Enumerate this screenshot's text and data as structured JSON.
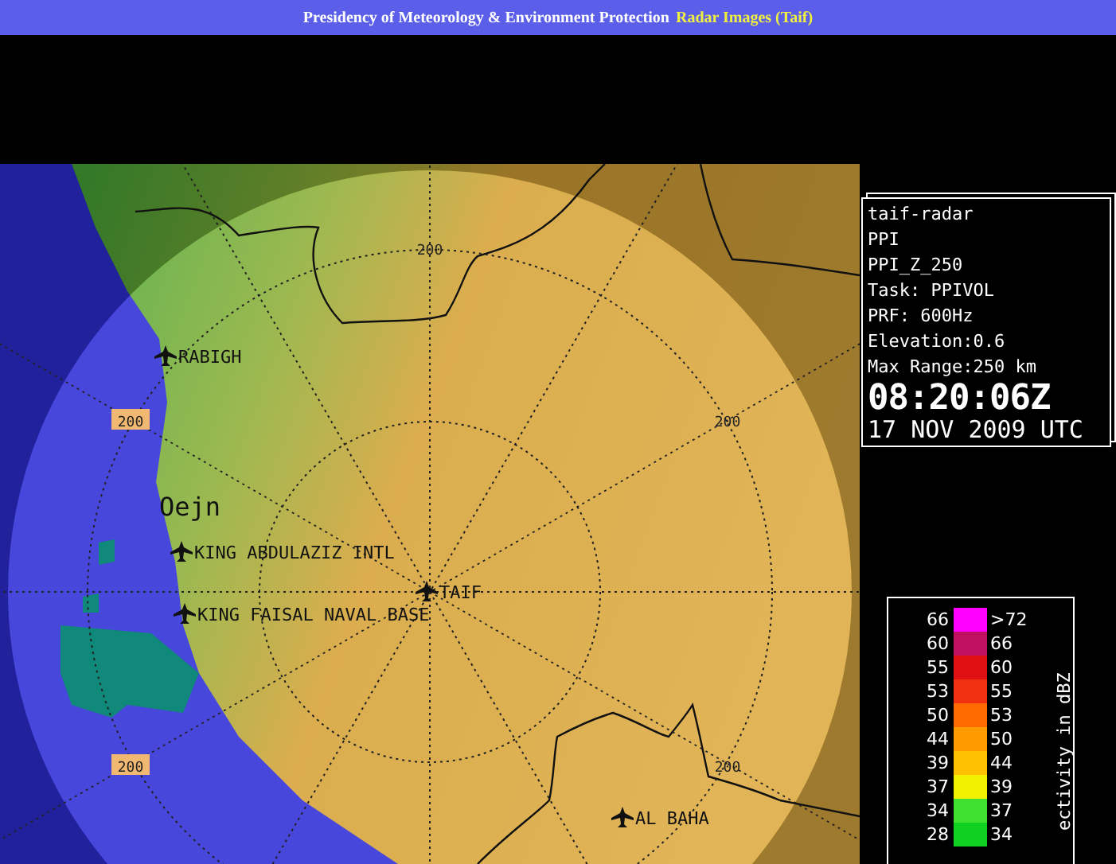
{
  "header": {
    "title": "Presidency of Meteorology & Environment Protection",
    "subtitle": "Radar Images (Taif)"
  },
  "map": {
    "range_labels": [
      {
        "text": "200",
        "kind": "plain"
      },
      {
        "text": "200",
        "kind": "plain"
      },
      {
        "text": "200",
        "kind": "boxed"
      },
      {
        "text": "200",
        "kind": "plain"
      },
      {
        "text": "200",
        "kind": "boxed"
      }
    ],
    "places": [
      {
        "name": "RABIGH",
        "kind": "airport"
      },
      {
        "name": "Oejn",
        "kind": "code"
      },
      {
        "name": "KING ABDULAZIZ INTL",
        "kind": "airport"
      },
      {
        "name": "TAIF",
        "kind": "airport"
      },
      {
        "name": "KING FAISAL NAVAL BASE",
        "kind": "airport"
      },
      {
        "name": "AL BAHA",
        "kind": "airport"
      }
    ]
  },
  "info": {
    "lines": [
      "taif-radar",
      "PPI",
      "PPI_Z_250",
      "Task: PPIVOL",
      "PRF: 600Hz",
      "Elevation:0.6",
      "Max Range:250 km"
    ],
    "time": "08:20:06Z",
    "date": "17 NOV 2009 UTC"
  },
  "legend": {
    "title": "ectivity in dBZ",
    "rows": [
      {
        "low": "66",
        "high": ">72",
        "color": "#ff00ff"
      },
      {
        "low": "60",
        "high": "66",
        "color": "#c01060"
      },
      {
        "low": "55",
        "high": "60",
        "color": "#e01010"
      },
      {
        "low": "53",
        "high": "55",
        "color": "#f03010"
      },
      {
        "low": "50",
        "high": "53",
        "color": "#ff6a00"
      },
      {
        "low": "44",
        "high": "50",
        "color": "#ff9a00"
      },
      {
        "low": "39",
        "high": "44",
        "color": "#ffc000"
      },
      {
        "low": "37",
        "high": "39",
        "color": "#f0f000"
      },
      {
        "low": "34",
        "high": "37",
        "color": "#40e030"
      },
      {
        "low": "28",
        "high": "34",
        "color": "#10d020"
      }
    ]
  }
}
